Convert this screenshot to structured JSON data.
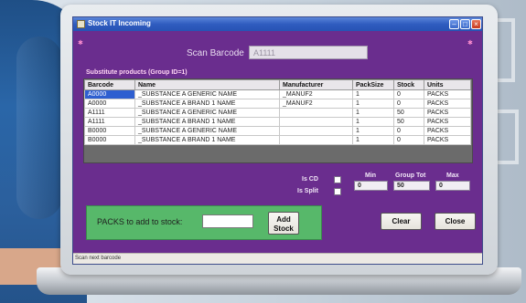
{
  "window": {
    "title": "Stock IT Incoming"
  },
  "scan": {
    "label": "Scan Barcode",
    "value": "A1111"
  },
  "substitute": {
    "label": "Substitute products   (Group ID=1)"
  },
  "grid": {
    "columns": [
      "Barcode",
      "Name",
      "Manufacturer",
      "PackSize",
      "Stock",
      "Units"
    ],
    "rows": [
      [
        "A0000",
        "_SUBSTANCE A GENERIC NAME",
        "_MANUF2",
        "1",
        "0",
        "PACKS"
      ],
      [
        "A0000",
        "_SUBSTANCE A BRAND 1 NAME",
        "_MANUF2",
        "1",
        "0",
        "PACKS"
      ],
      [
        "A1111",
        "_SUBSTANCE A GENERIC NAME",
        "",
        "1",
        "50",
        "PACKS"
      ],
      [
        "A1111",
        "_SUBSTANCE A BRAND 1 NAME",
        "",
        "1",
        "50",
        "PACKS"
      ],
      [
        "B0000",
        "_SUBSTANCE A GENERIC NAME",
        "",
        "1",
        "0",
        "PACKS"
      ],
      [
        "B0000",
        "_SUBSTANCE A BRAND 1 NAME",
        "",
        "1",
        "0",
        "PACKS"
      ]
    ]
  },
  "flags": {
    "is_cd_label": "Is CD",
    "is_split_label": "Is Split"
  },
  "levels": {
    "min_label": "Min",
    "group_tot_label": "Group Tot",
    "max_label": "Max",
    "min_value": "0",
    "group_tot_value": "50",
    "max_value": "0"
  },
  "add_stock": {
    "label": "PACKS to add to stock:",
    "quantity_value": "",
    "button_label": "Add Stock"
  },
  "buttons": {
    "clear": "Clear",
    "close": "Close"
  },
  "status": {
    "text": "Scan next barcode"
  },
  "colors": {
    "window_bg": "#6a2d8e",
    "panel_green": "#57b86a",
    "selection": "#2e5fd0"
  }
}
